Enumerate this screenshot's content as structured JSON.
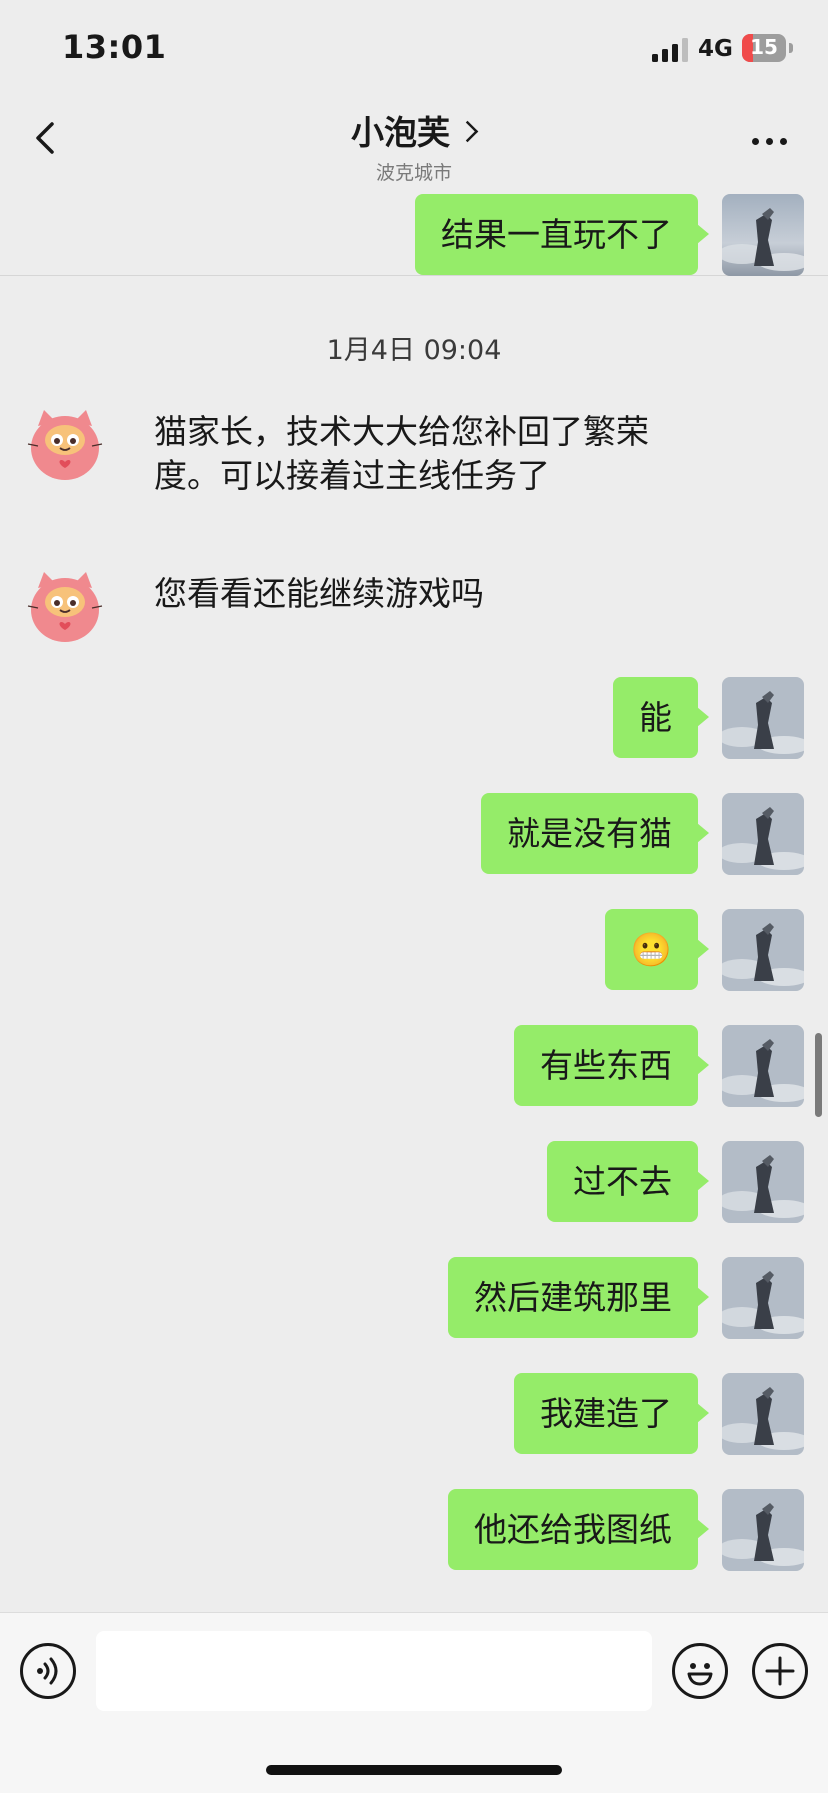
{
  "status_bar": {
    "time": "13:01",
    "network": "4G",
    "battery": "15"
  },
  "header": {
    "title": "小泡芙",
    "subtitle": "波克城市"
  },
  "messages": {
    "m0": "结果一直玩不了",
    "timestamp": "1月4日 09:04",
    "l1_line1": "猫家长，技术大大给您补回了繁荣",
    "l1_line2": "度。可以接着过主线任务了",
    "l2": "您看看还能继续游戏吗",
    "r1": "能",
    "r2": "就是没有猫",
    "r3": "😬",
    "r4": "有些东西",
    "r5": "过不去",
    "r6": "然后建筑那里",
    "r7": "我建造了",
    "r8": "他还给我图纸"
  },
  "icons": {
    "back": "chevron-left-icon",
    "more": "more-dots-icon",
    "voice": "voice-icon",
    "emoji": "emoji-icon",
    "plus": "plus-icon"
  },
  "colors": {
    "background": "#ededed",
    "outgoing_bubble": "#95ec69",
    "cat_avatar": "#f0898e",
    "battery_low": "#f04b4b"
  }
}
